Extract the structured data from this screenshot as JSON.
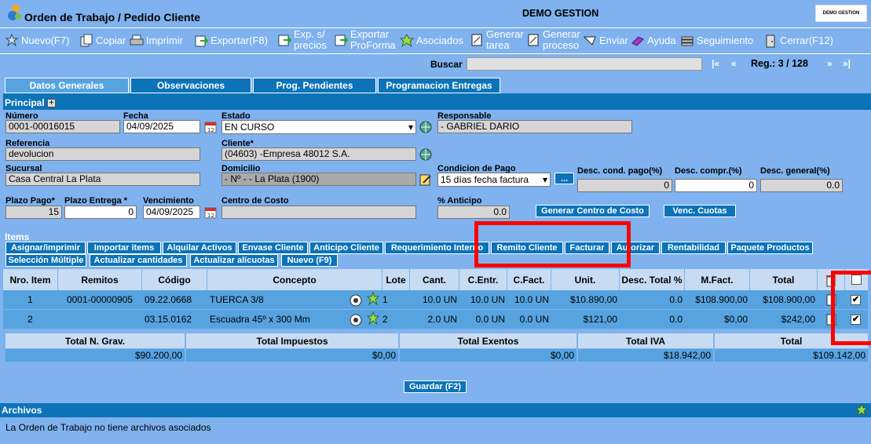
{
  "window": {
    "title": "Orden de Trabajo / Pedido Cliente",
    "company": "DEMO GESTION",
    "logo_text": "DEMO GESTION"
  },
  "toolbar": {
    "nuevo": "Nuevo(F7)",
    "copiar": "Copiar",
    "imprimir": "Imprimir",
    "exportar": "Exportar(F8)",
    "exp_precios_1": "Exp. s/",
    "exp_precios_2": "precios",
    "exp_proforma_1": "Exportar",
    "exp_proforma_2": "ProForma",
    "asociados": "Asociados",
    "gen_tarea_1": "Generar",
    "gen_tarea_2": "tarea",
    "gen_proceso_1": "Generar",
    "gen_proceso_2": "proceso",
    "enviar": "Enviar",
    "ayuda": "Ayuda",
    "seguimiento": "Seguimiento",
    "cerrar": "Cerrar(F12)"
  },
  "search": {
    "label": "Buscar",
    "value": "",
    "first": "|«",
    "prev": "«",
    "next": "»",
    "last": "»|",
    "reg": "Reg.: 3 / 128"
  },
  "tabs": [
    "Datos Generales",
    "Observaciones",
    "Prog. Pendientes",
    "Programacion Entregas"
  ],
  "principal": {
    "header": "Principal",
    "numero_label": "Número",
    "numero": "0001-00016015",
    "fecha_label": "Fecha",
    "fecha": "04/09/2025",
    "estado_label": "Estado",
    "estado": "EN CURSO",
    "responsable_label": "Responsable",
    "responsable": "- GABRIEL DARIO",
    "referencia_label": "Referencia",
    "referencia": "devolucion",
    "cliente_label": "Cliente*",
    "cliente": "(04603) -Empresa 48012 S.A.",
    "sucursal_label": "Sucursal",
    "sucursal": "Casa Central La Plata",
    "domicilio_label": "Domicilio",
    "domicilio": "- Nº - - La Plata (1900)",
    "condicion_label": "Condicion de Pago",
    "condicion": "15 días fecha factura",
    "dots": "...",
    "desc_cond_label": "Desc. cond. pago(%)",
    "desc_cond": "0",
    "desc_compr_label": "Desc. compr.(%)",
    "desc_compr": "0",
    "desc_gen_label": "Desc. general(%)",
    "desc_gen": "0.0",
    "plazo_pago_label": "Plazo Pago*",
    "plazo_pago": "15",
    "plazo_entrega_label": "Plazo Entrega *",
    "plazo_entrega": "0",
    "vencimiento_label": "Vencimiento",
    "vencimiento": "04/09/2025",
    "centro_costo_label": "Centro de Costo",
    "centro_costo": "",
    "anticipo_label": "% Anticipo",
    "anticipo": "0.0",
    "gen_centro_btn": "Generar Centro de Costo",
    "venc_cuotas_btn": "Venc. Cuotas"
  },
  "items": {
    "header": "Items",
    "buttons_row1": [
      "Asignar/imprimir",
      "Importar items",
      "Alquilar Activos",
      "Envase Cliente",
      "Anticipo Cliente",
      "Requerimiento Interno",
      "Remito Cliente",
      "Facturar",
      "Autorizar",
      "Rentabilidad",
      "Paquete Productos"
    ],
    "buttons_row2": [
      "Selección Múltiple",
      "Actualizar cantidades",
      "Actualizar alícuotas",
      "Nuevo (F9)"
    ],
    "columns": [
      "Nro. Item",
      "Remitos",
      "Código",
      "Concepto",
      "Lote",
      "Cant.",
      "C.Entr.",
      "C.Fact.",
      "Unit.",
      "Desc. Total %",
      "M.Fact.",
      "Total"
    ],
    "rows": [
      {
        "nro": "1",
        "remitos": "0001-00000905",
        "codigo": "09.22.0668",
        "concepto": "TUERCA 3/8",
        "lote": "1",
        "cant": "10.0 UN",
        "centr": "10.0 UN",
        "cfact": "10.0 UN",
        "unit": "$10.890,00",
        "desc": "0.0",
        "mfact": "$108.900,00",
        "total": "$108.900,00",
        "checked": true
      },
      {
        "nro": "2",
        "remitos": "",
        "codigo": "03.15.0162",
        "concepto": "Escuadra 45º x 300 Mm",
        "lote": "2",
        "cant": "2.0 UN",
        "centr": "0.0 UN",
        "cfact": "0.0 UN",
        "unit": "$121,00",
        "desc": "0.0",
        "mfact": "$0,00",
        "total": "$242,00",
        "checked": true
      }
    ],
    "totals_headers": [
      "Total N. Grav.",
      "Total Impuestos",
      "Total Exentos",
      "Total IVA",
      "Total"
    ],
    "totals_values": [
      "$90.200,00",
      "$0,00",
      "$0,00",
      "$18.942,00",
      "$109.142,00"
    ],
    "check_mark": "✔",
    "guardar": "Guardar (F2)"
  },
  "archivos": {
    "header": "Archivos",
    "message": "La Orden de Trabajo no tiene archivos asociados"
  },
  "colors": {
    "accent": "#0c73b8",
    "background": "#7fb2ee",
    "row": "#56a3e0",
    "highlight": "#ff0000"
  }
}
